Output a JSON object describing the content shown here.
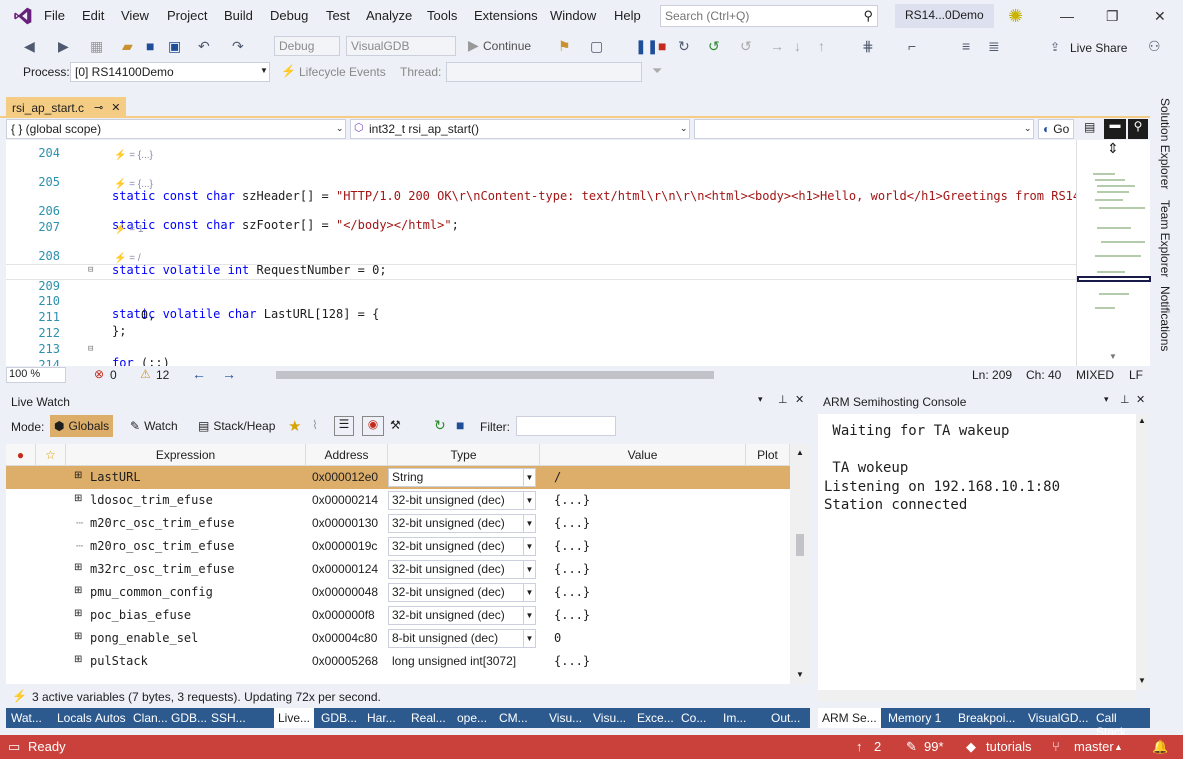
{
  "menu": {
    "items": [
      "File",
      "Edit",
      "View",
      "Project",
      "Build",
      "Debug",
      "Test",
      "Analyze",
      "Tools",
      "Extensions",
      "Window",
      "Help"
    ],
    "search_placeholder": "Search (Ctrl+Q)",
    "solution_name": "RS14...0Demo"
  },
  "toolbar": {
    "config": "Debug",
    "platform": "VisualGDB",
    "continue_label": "Continue",
    "live_share": "Live Share"
  },
  "process_bar": {
    "process_label": "Process:",
    "process_value": "[0] RS14100Demo",
    "lifecycle_label": "Lifecycle Events",
    "thread_label": "Thread:"
  },
  "editor": {
    "tab_name": "rsi_ap_start.c",
    "scope": "{ } (global scope)",
    "function": "int32_t rsi_ap_start()",
    "go_label": "Go",
    "lines": [
      {
        "num": "204",
        "code": ""
      },
      {
        "num": "205",
        "code": "static const char szHeader[] = \"HTTP/1.0 200 OK\\r\\nContent-type: text/html\\r\\n\\r\\n<html><body><h1>Hello, world</h1>Greetings from RS14100!"
      },
      {
        "num": "206",
        "code": "static const char szFooter[] = \"</body></html>\";"
      },
      {
        "num": "207",
        "code": ""
      },
      {
        "num": "208",
        "code": "static volatile int RequestNumber = 0;"
      },
      {
        "num": "209",
        "code": "static volatile char LastURL[128] = {"
      },
      {
        "num": "210",
        "code": "    0,"
      },
      {
        "num": "211",
        "code": "};"
      },
      {
        "num": "212",
        "code": ""
      },
      {
        "num": "213",
        "code": "for (;;)"
      },
      {
        "num": "214",
        "code": "{"
      }
    ],
    "lens": [
      "= {...}",
      "= {...}",
      "= 1",
      "= /"
    ],
    "zoom": "100 %",
    "errors": "0",
    "warnings": "12",
    "position_line": "Ln: 209",
    "position_col": "Ch: 40",
    "encoding": "MIXED",
    "line_ending": "LF"
  },
  "side_tabs": [
    "Solution Explorer",
    "Team Explorer",
    "Notifications"
  ],
  "live_watch": {
    "title": "Live Watch",
    "mode_label": "Mode:",
    "modes": [
      "Globals",
      "Watch",
      "Stack/Heap"
    ],
    "filter_label": "Filter:",
    "columns": [
      "Expression",
      "Address",
      "Type",
      "Value",
      "Plot"
    ],
    "rows": [
      {
        "name": "LastURL",
        "address": "0x000012e0",
        "type": "String",
        "value": "/",
        "combo": true
      },
      {
        "name": "ldosoc_trim_efuse",
        "address": "0x00000214",
        "type": "32-bit unsigned (dec)",
        "value": "{...}",
        "combo": true
      },
      {
        "name": "m20rc_osc_trim_efuse",
        "address": "0x00000130",
        "type": "32-bit unsigned (dec)",
        "value": "{...}",
        "combo": true
      },
      {
        "name": "m20ro_osc_trim_efuse",
        "address": "0x0000019c",
        "type": "32-bit unsigned (dec)",
        "value": "{...}",
        "combo": true
      },
      {
        "name": "m32rc_osc_trim_efuse",
        "address": "0x00000124",
        "type": "32-bit unsigned (dec)",
        "value": "{...}",
        "combo": true
      },
      {
        "name": "pmu_common_config",
        "address": "0x00000048",
        "type": "32-bit unsigned (dec)",
        "value": "{...}",
        "combo": true
      },
      {
        "name": "poc_bias_efuse",
        "address": "0x000000f8",
        "type": "32-bit unsigned (dec)",
        "value": "{...}",
        "combo": true
      },
      {
        "name": "pong_enable_sel",
        "address": "0x00004c80",
        "type": "8-bit unsigned (dec)",
        "value": "0",
        "combo": true
      },
      {
        "name": "pulStack",
        "address": "0x00005268",
        "type": "long unsigned int[3072]",
        "value": "{...}",
        "combo": false
      }
    ],
    "status": "3 active variables (7 bytes, 3 requests). Updating 72x per second.",
    "tabs": [
      "Wat...",
      "Locals",
      "Autos",
      "Clan...",
      "GDB...",
      "SSH...",
      "Live...",
      "GDB...",
      "Har...",
      "Real...",
      "ope...",
      "CM...",
      "Visu...",
      "Visu...",
      "Exce...",
      "Co...",
      "Im...",
      "Out..."
    ]
  },
  "arm_console": {
    "title": "ARM Semihosting Console",
    "text": " Waiting for TA wakeup\n\n TA wokeup\nListening on 192.168.10.1:80\nStation connected",
    "tabs": [
      "ARM Se...",
      "Memory 1",
      "Breakpoi...",
      "VisualGD...",
      "Call Stack"
    ]
  },
  "statusbar": {
    "ready": "Ready",
    "up_count": "2",
    "pencil_count": "99*",
    "repo": "tutorials",
    "branch": "master"
  },
  "colors": {
    "statusbar": "#c9413a",
    "selected_row": "#dcae6a",
    "tab_highlight": "#f5cc84",
    "bottom_tabs": "#2d5a8e"
  }
}
